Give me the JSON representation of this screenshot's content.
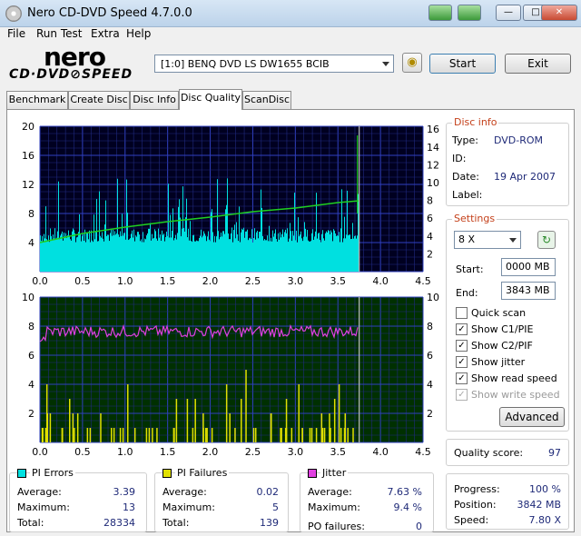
{
  "window": {
    "title": "Nero CD-DVD Speed 4.7.0.0"
  },
  "menu": [
    "File",
    "Run Test",
    "Extra",
    "Help"
  ],
  "logo": {
    "top": "nero",
    "bottom": "CD·DVD⊘SPEED"
  },
  "drive": {
    "selected": "[1:0]   BENQ DVD LS DW1655 BCIB"
  },
  "buttons": {
    "start": "Start",
    "exit": "Exit",
    "advanced": "Advanced"
  },
  "tabs": [
    "Benchmark",
    "Create Disc",
    "Disc Info",
    "Disc Quality",
    "ScanDisc"
  ],
  "active_tab": "Disc Quality",
  "disc_info": {
    "title": "Disc info",
    "type_label": "Type:",
    "type": "DVD-ROM",
    "id_label": "ID:",
    "id": "",
    "date_label": "Date:",
    "date": "19 Apr 2007",
    "label_label": "Label:",
    "label": ""
  },
  "settings": {
    "title": "Settings",
    "speed": "8 X",
    "start_label": "Start:",
    "start": "0000 MB",
    "end_label": "End:",
    "end": "3843 MB",
    "quick_scan": "Quick scan",
    "show_c1pie": "Show C1/PIE",
    "show_c2pif": "Show C2/PIF",
    "show_jitter": "Show jitter",
    "show_read_speed": "Show read speed",
    "show_write_speed": "Show write speed"
  },
  "quality": {
    "label": "Quality score:",
    "value": "97"
  },
  "progress": {
    "progress_label": "Progress:",
    "progress": "100 %",
    "position_label": "Position:",
    "position": "3842 MB",
    "speed_label": "Speed:",
    "speed": "7.80 X"
  },
  "pi_errors": {
    "title": "PI Errors",
    "avg_label": "Average:",
    "avg": "3.39",
    "max_label": "Maximum:",
    "max": "13",
    "total_label": "Total:",
    "total": "28334"
  },
  "pi_failures": {
    "title": "PI Failures",
    "avg_label": "Average:",
    "avg": "0.02",
    "max_label": "Maximum:",
    "max": "5",
    "total_label": "Total:",
    "total": "139"
  },
  "jitter": {
    "title": "Jitter",
    "avg_label": "Average:",
    "avg": "7.63 %",
    "max_label": "Maximum:",
    "max": "9.4 %",
    "po_label": "PO failures:",
    "po": "0"
  },
  "colors": {
    "pie": "#00e0e0",
    "pif": "#e0e000",
    "jitter": "#e040e0",
    "read": "#20d020",
    "top_bg": "#000020",
    "bottom_bg": "#003000"
  },
  "chart_data": [
    {
      "type": "bar",
      "name": "PI errors with read speed",
      "x_ticks": [
        "0.0",
        "0.5",
        "1.0",
        "1.5",
        "2.0",
        "2.5",
        "3.0",
        "3.5",
        "4.0",
        "4.5"
      ],
      "y_left_ticks": [
        "20",
        "16",
        "12",
        "8",
        "4"
      ],
      "y_right_ticks": [
        "16",
        "14",
        "12",
        "10",
        "8",
        "6",
        "4",
        "2"
      ],
      "xlim": [
        0,
        4.5
      ],
      "ylim": [
        0,
        20
      ],
      "data_end": 3.75,
      "pie_base_level": 4,
      "pie_max": 13,
      "read_speed": {
        "x": [
          0.0,
          0.5,
          1.0,
          1.5,
          2.0,
          2.5,
          3.0,
          3.5,
          3.75
        ],
        "y": [
          3.2,
          4.2,
          4.9,
          5.5,
          6.0,
          6.6,
          7.0,
          7.6,
          7.8
        ]
      }
    },
    {
      "type": "bar",
      "name": "PI failures with jitter",
      "x_ticks": [
        "0.0",
        "0.5",
        "1.0",
        "1.5",
        "2.0",
        "2.5",
        "3.0",
        "3.5",
        "4.0",
        "4.5"
      ],
      "y_left_ticks": [
        "10",
        "8",
        "6",
        "4",
        "2"
      ],
      "y_right_ticks": [
        "10",
        "8",
        "6",
        "4",
        "2"
      ],
      "xlim": [
        0,
        4.5
      ],
      "ylim": [
        0,
        10
      ],
      "data_end": 3.75,
      "jitter_avg": 7.63,
      "pif_max": 5
    }
  ]
}
